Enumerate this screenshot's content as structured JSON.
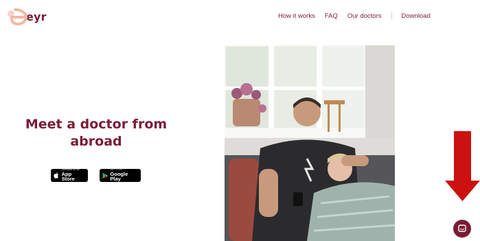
{
  "header": {
    "logo_text": "eyr",
    "nav": {
      "how_it_works": "How it works",
      "faq": "FAQ",
      "our_doctors": "Our doctors",
      "download": "Download"
    }
  },
  "hero": {
    "title_line1": "Meet a doctor from",
    "title_line2": "abroad",
    "app_store": {
      "small": "Download on the",
      "big": "App Store"
    },
    "google_play": {
      "small": "GET IT ON",
      "big": "Google Play"
    }
  },
  "icons": {
    "chat": "chat-icon",
    "annotation": "red-down-arrow"
  },
  "colors": {
    "brand": "#7a1c34",
    "logo_accent": "#f2b8a6",
    "annotation_red": "#cc1111"
  }
}
